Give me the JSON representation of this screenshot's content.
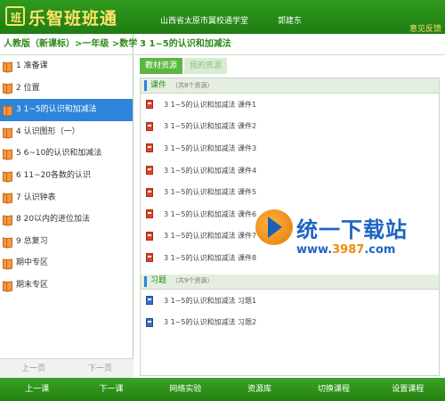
{
  "header": {
    "app_title": "乐智班班通",
    "logo_glyph": "班",
    "school": "山西省太原市翼校通学堂",
    "user": "郭建东",
    "feedback": "意见反馈"
  },
  "sidebar": {
    "heading": "人教版（新课标）>一年级 >数学",
    "chapters": [
      {
        "label": "1 准备课"
      },
      {
        "label": "2 位置"
      },
      {
        "label": "3 1~5的认识和加减法"
      },
      {
        "label": "4 认识图形（一）"
      },
      {
        "label": "5 6~10的认识和加减法"
      },
      {
        "label": "6 11~20各数的认识"
      },
      {
        "label": "7 认识钟表"
      },
      {
        "label": "8 20以内的进位加法"
      },
      {
        "label": "9 总复习"
      },
      {
        "label": "期中专区"
      },
      {
        "label": "期末专区"
      }
    ],
    "active_index": 2,
    "pager": {
      "prev": "上一页",
      "next": "下一页"
    }
  },
  "main": {
    "breadcrumb": "3 1~5的认识和加减法",
    "tabs": [
      {
        "label": "教材资源",
        "active": true
      },
      {
        "label": "我的资源",
        "active": false
      }
    ],
    "sections": [
      {
        "title": "课件",
        "count": "（共8个资源）",
        "kind": "courseware",
        "items": [
          "3 1~5的认识和加减法 课件1",
          "3 1~5的认识和加减法 课件2",
          "3 1~5的认识和加减法 课件3",
          "3 1~5的认识和加减法 课件4",
          "3 1~5的认识和加减法 课件5",
          "3 1~5的认识和加减法 课件6",
          "3 1~5的认识和加减法 课件7",
          "3 1~5的认识和加减法 课件8"
        ]
      },
      {
        "title": "习题",
        "count": "（共9个资源）",
        "kind": "exercise",
        "items": [
          "3 1~5的认识和加减法 习题1",
          "3 1~5的认识和加减法 习题2"
        ]
      }
    ]
  },
  "watermark": {
    "text": "统一下载站",
    "url_prefix": "www.",
    "url_number": "3987",
    "url_suffix": ".com"
  },
  "footer": {
    "buttons": [
      {
        "label": "上一课",
        "name": "prev-lesson-button"
      },
      {
        "label": "下一课",
        "name": "next-lesson-button"
      },
      {
        "label": "网络实验",
        "name": "online-lab-button"
      },
      {
        "label": "资源库",
        "name": "resource-library-button"
      },
      {
        "label": "切换课程",
        "name": "switch-course-button"
      },
      {
        "label": "设置课程",
        "name": "set-course-button"
      }
    ]
  },
  "colors": {
    "brand_green": "#2f9a1e",
    "accent_yellow": "#ffe36a",
    "selection_blue": "#2e84d8"
  }
}
